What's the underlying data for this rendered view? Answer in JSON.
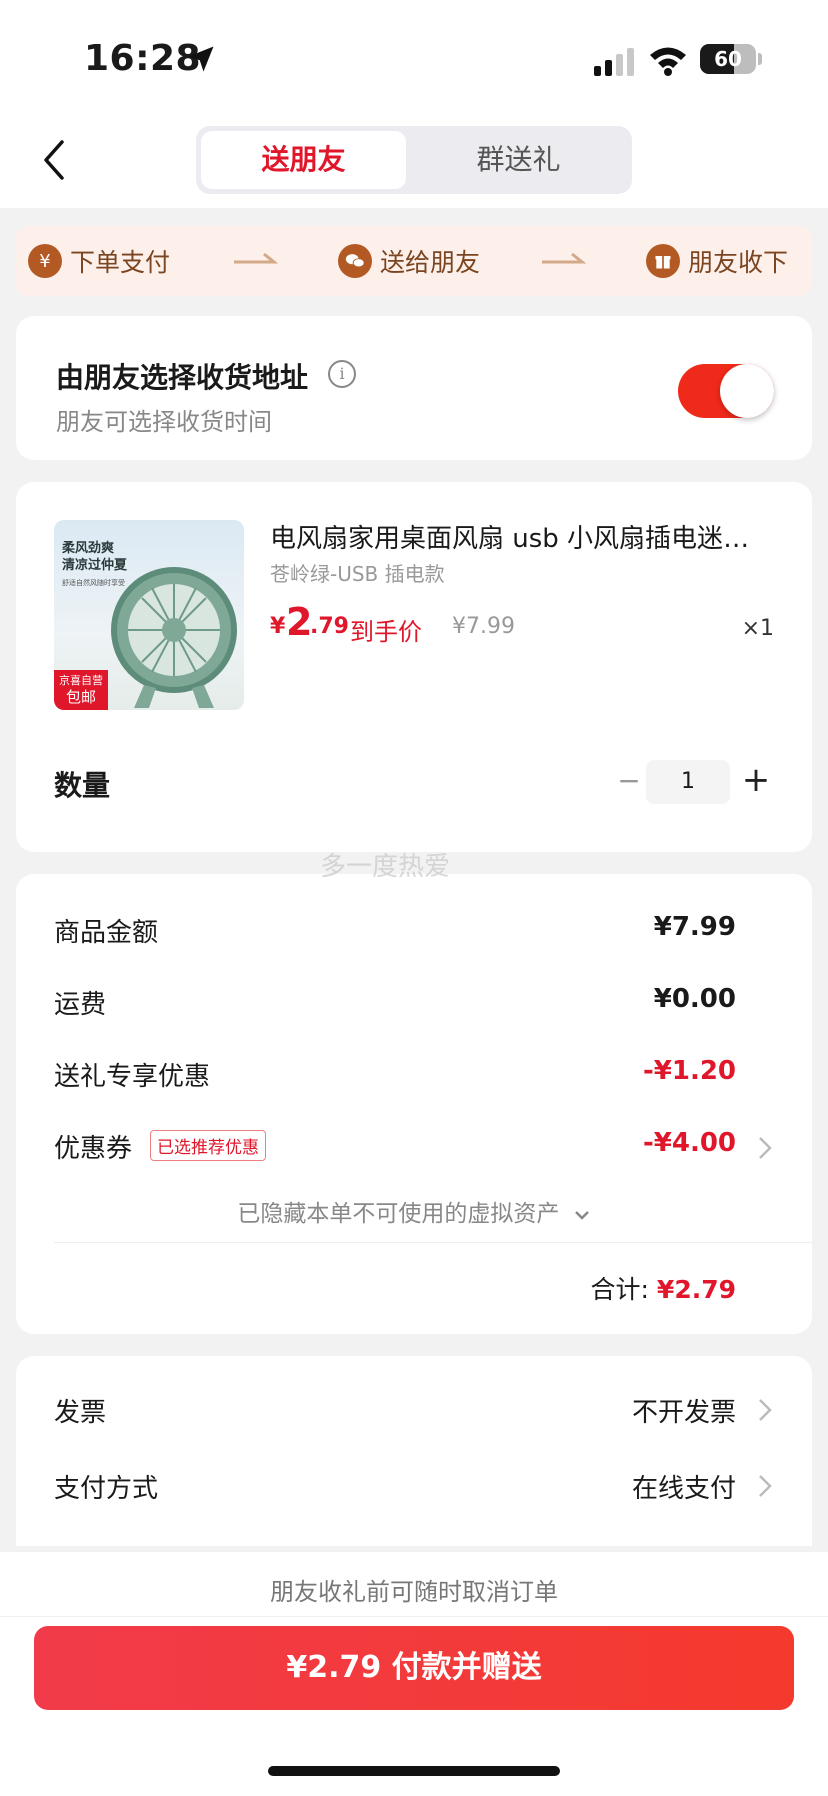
{
  "status_bar": {
    "time": "16:28",
    "battery_text": "60",
    "battery_level": 0.6
  },
  "tabs": {
    "active": "送朋友",
    "inactive": "群送礼"
  },
  "steps": [
    {
      "icon": "yen-coin-icon",
      "label": "下单支付"
    },
    {
      "icon": "wechat-icon",
      "label": "送给朋友"
    },
    {
      "icon": "gift-icon",
      "label": "朋友收下"
    }
  ],
  "address_option": {
    "title": "由朋友选择收货地址",
    "subtitle": "朋友可选择收货时间",
    "toggle_on": true
  },
  "product": {
    "title": "电风扇家用桌面风扇 usb 小风扇插电迷你...",
    "variant": "苍岭绿-USB 插电款",
    "price_symbol": "¥",
    "price_int": "2",
    "price_dec": ".79",
    "price_label": "到手价",
    "original_price": "¥7.99",
    "qty_text": "×1",
    "image_text": "柔风劲爽\n清凉过仲夏",
    "image_small": "舒适自然风随时享受",
    "image_badge_top": "京喜自营",
    "image_badge_bottom": "包邮"
  },
  "quantity": {
    "label": "数量",
    "value": "1",
    "minus": "−",
    "plus": "+"
  },
  "watermark": "多一度热爱",
  "summary": {
    "goods_label": "商品金额",
    "goods_value": "¥7.99",
    "shipping_label": "运费",
    "shipping_value": "¥0.00",
    "gift_discount_label": "送礼专享优惠",
    "gift_discount_value": "-¥1.20",
    "coupon_label": "优惠券",
    "coupon_tag": "已选推荐优惠",
    "coupon_value": "-¥4.00",
    "hidden_assets_note": "已隐藏本单不可使用的虚拟资产",
    "total_label": "合计:",
    "total_value": "¥2.79"
  },
  "invoice": {
    "label": "发票",
    "value": "不开发票"
  },
  "payment": {
    "label": "支付方式",
    "value": "在线支付"
  },
  "footer": {
    "cancel_note": "朋友收礼前可随时取消订单",
    "pay_button": "¥2.79 付款并赠送"
  },
  "colors": {
    "accent_red": "#e0162b",
    "toggle_red": "#f02a1a",
    "step_brown": "#b35a24"
  }
}
